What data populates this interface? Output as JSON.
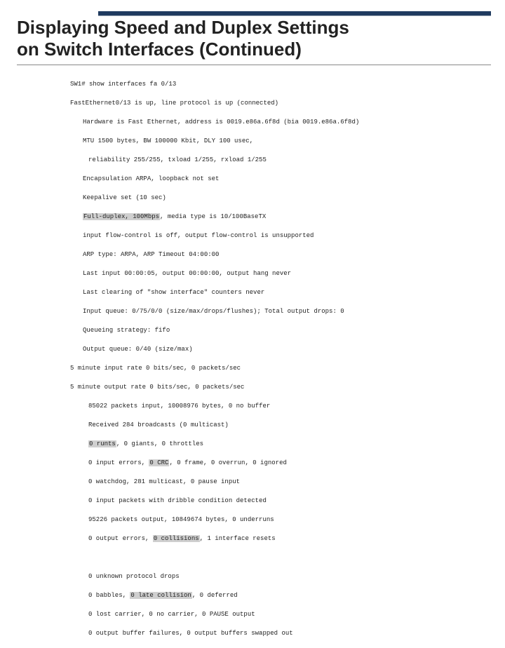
{
  "title_line1": "Displaying Speed and Duplex Settings",
  "title_line2": "on Switch Interfaces (Continued)",
  "cli": {
    "cmd": "SW1# show interfaces fa 0/13",
    "l1": "FastEthernet0/13 is up, line protocol is up (connected)",
    "l2": "Hardware is Fast Ethernet, address is 0019.e86a.6f8d (bia 0019.e86a.6f8d)",
    "l3": "MTU 1500 bytes, BW 100000 Kbit, DLY 100 usec,",
    "l4": "reliability 255/255, txload 1/255, rxload 1/255",
    "l5": "Encapsulation ARPA, loopback not set",
    "l6": "Keepalive set (10 sec)",
    "l7a": "Full-duplex, 100Mbps",
    "l7b": ", media type is 10/100BaseTX",
    "l8": "input flow-control is off, output flow-control is unsupported",
    "l9": "ARP type: ARPA, ARP Timeout 04:00:00",
    "l10": "Last input 00:00:05, output 00:00:00, output hang never",
    "l11": "Last clearing of \"show interface\" counters never",
    "l12": "Input queue: 0/75/0/0 (size/max/drops/flushes); Total output drops: 0",
    "l13": "Queueing strategy: fifo",
    "l14": "Output queue: 0/40 (size/max)",
    "l15": "5 minute input rate 0 bits/sec, 0 packets/sec",
    "l16": "5 minute output rate 0 bits/sec, 0 packets/sec",
    "l17": "85022 packets input, 10008976 bytes, 0 no buffer",
    "l18": "Received 284 broadcasts (0 multicast)",
    "l19a": "0 runts",
    "l19b": ", 0 giants, 0 throttles",
    "l20a": "0 input errors, ",
    "l20b": "0 CRC",
    "l20c": ", 0 frame, 0 overrun, 0 ignored",
    "l21": "0 watchdog, 281 multicast, 0 pause input",
    "l22": "0 input packets with dribble condition detected",
    "l23": "95226 packets output, 10849674 bytes, 0 underruns",
    "l24a": "0 output errors, ",
    "l24b": "0 collisions",
    "l24c": ", 1 interface resets",
    "l25": "0 unknown protocol drops",
    "l26a": "0 babbles, ",
    "l26b": "0 late collision",
    "l26c": ", 0 deferred",
    "l27": "0 lost carrier, 0 no carrier, 0 PAUSE output",
    "l28": "0 output buffer failures, 0 output buffers swapped out"
  }
}
